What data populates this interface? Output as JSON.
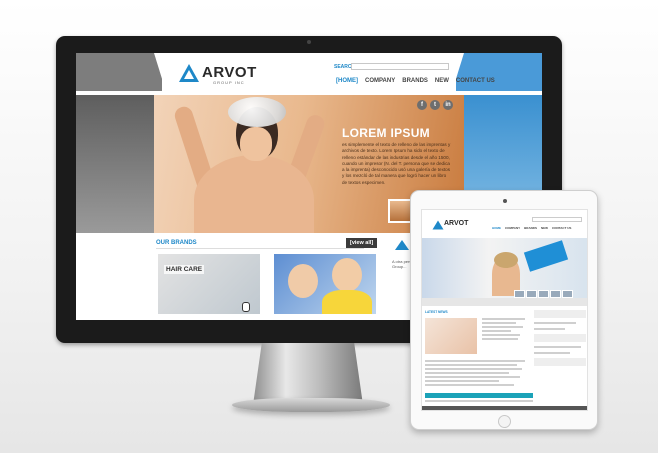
{
  "site": {
    "logo_text": "ARVOT",
    "logo_sub": "GROUP INC",
    "search_label": "SEARCH",
    "nav": [
      "[HOME]",
      "COMPANY",
      "BRANDS",
      "NEW",
      "CONTACT US"
    ],
    "social": [
      "f",
      "t",
      "in"
    ],
    "hero_title": "LOREM IPSUM",
    "hero_text": "es simplemente el texto de relleno de las imprentas y archivos de texto. Lorem Ipsum ha sido el texto de relleno estándar de las industrias desde el año 1500, cuando un impresor (N. del T. persona que se dedica a la imprenta) desconocido usó una galería de textos y los mezcló de tal manera que logró hacer un libro de textos especimen.",
    "brands_title": "OUR BRANDS",
    "view_all": "[view all]",
    "card1_label": "HAIR CARE",
    "side_text": "A otra persona... Arvot Group..."
  },
  "tablet": {
    "logo_text": "ARVOT",
    "nav": [
      "HOME",
      "COMPANY",
      "BRANDS",
      "NEW",
      "CONTACT US"
    ],
    "section_title": "LATEST NEWS"
  },
  "colors": {
    "accent": "#1e88c8",
    "header_left": "#7d7d7d",
    "header_right": "#4a9ad8",
    "teal": "#1ba2b8"
  }
}
